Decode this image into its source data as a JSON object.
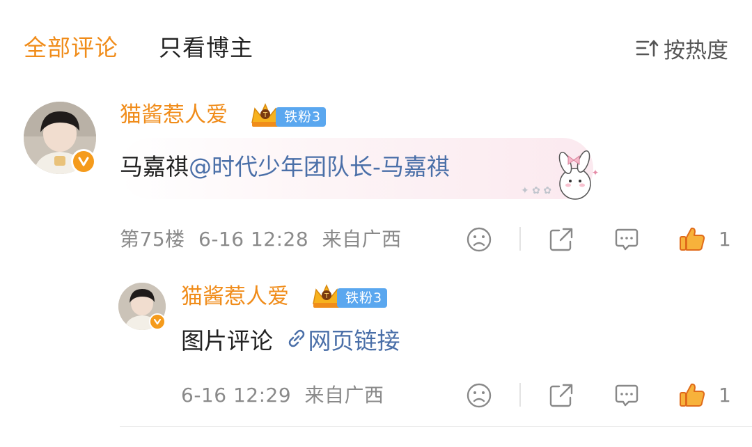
{
  "header": {
    "tabs": [
      {
        "label": "全部评论",
        "active": true
      },
      {
        "label": "只看博主",
        "active": false
      }
    ],
    "sort_label": "按热度"
  },
  "comment": {
    "username": "猫酱惹人爱",
    "badge_text": "铁粉3",
    "text": "马嘉祺",
    "mention": "@时代少年团队长-马嘉祺",
    "floor": "第75楼",
    "time": "6-16 12:28",
    "location": "来自广西",
    "like_count": "1"
  },
  "reply": {
    "username": "猫酱惹人爱",
    "badge_text": "铁粉3",
    "text": "图片评论",
    "link_label": "网页链接",
    "time": "6-16 12:29",
    "location": "来自广西",
    "like_count": "1"
  },
  "colors": {
    "accent": "#f08c1a",
    "mention": "#4a6fa8",
    "fan_badge": "#5aa7ef",
    "verified": "#f59b1c",
    "like": "#f5881f"
  },
  "icons": {
    "sort": "sort-icon",
    "avatar_badge": "verified-v-icon",
    "crown": "crown-icon",
    "dislike": "sad-face-icon",
    "share": "share-icon",
    "reply": "comment-icon",
    "like": "thumbs-up-icon",
    "link": "link-icon",
    "decoration": "bunny-sticker-icon"
  }
}
